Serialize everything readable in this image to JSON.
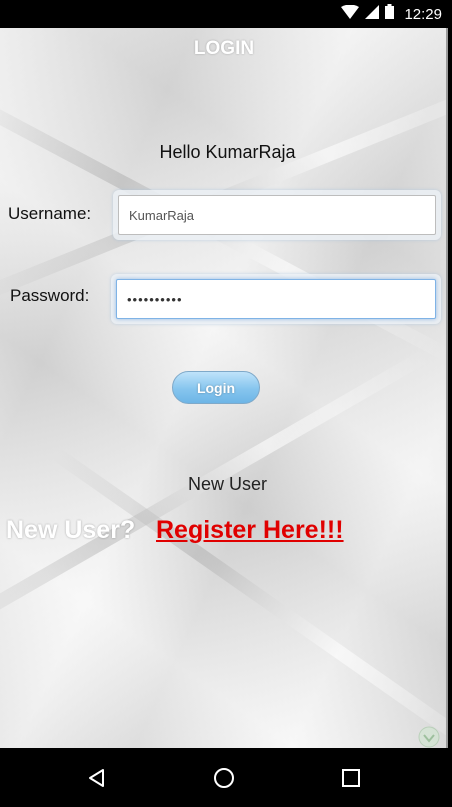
{
  "status_bar": {
    "time": "12:29",
    "icons": [
      "wifi-icon",
      "signal-icon",
      "battery-icon"
    ]
  },
  "page": {
    "title": "LOGIN",
    "greeting": "Hello KumarRaja"
  },
  "form": {
    "username_label": "Username:",
    "username_value": "KumarRaja",
    "password_label": "Password:",
    "password_value": "••••••••••",
    "login_button": "Login"
  },
  "register": {
    "new_user_text": "New User",
    "question": "New User?",
    "link_text": "Register Here!!!"
  },
  "nav_bar": {
    "buttons": [
      "back-icon",
      "home-icon",
      "recents-icon"
    ]
  },
  "colors": {
    "link": "#e00000",
    "button_gradient_top": "#bfe3fa",
    "button_gradient_bottom": "#6db5e6",
    "status_bar": "#000000"
  }
}
